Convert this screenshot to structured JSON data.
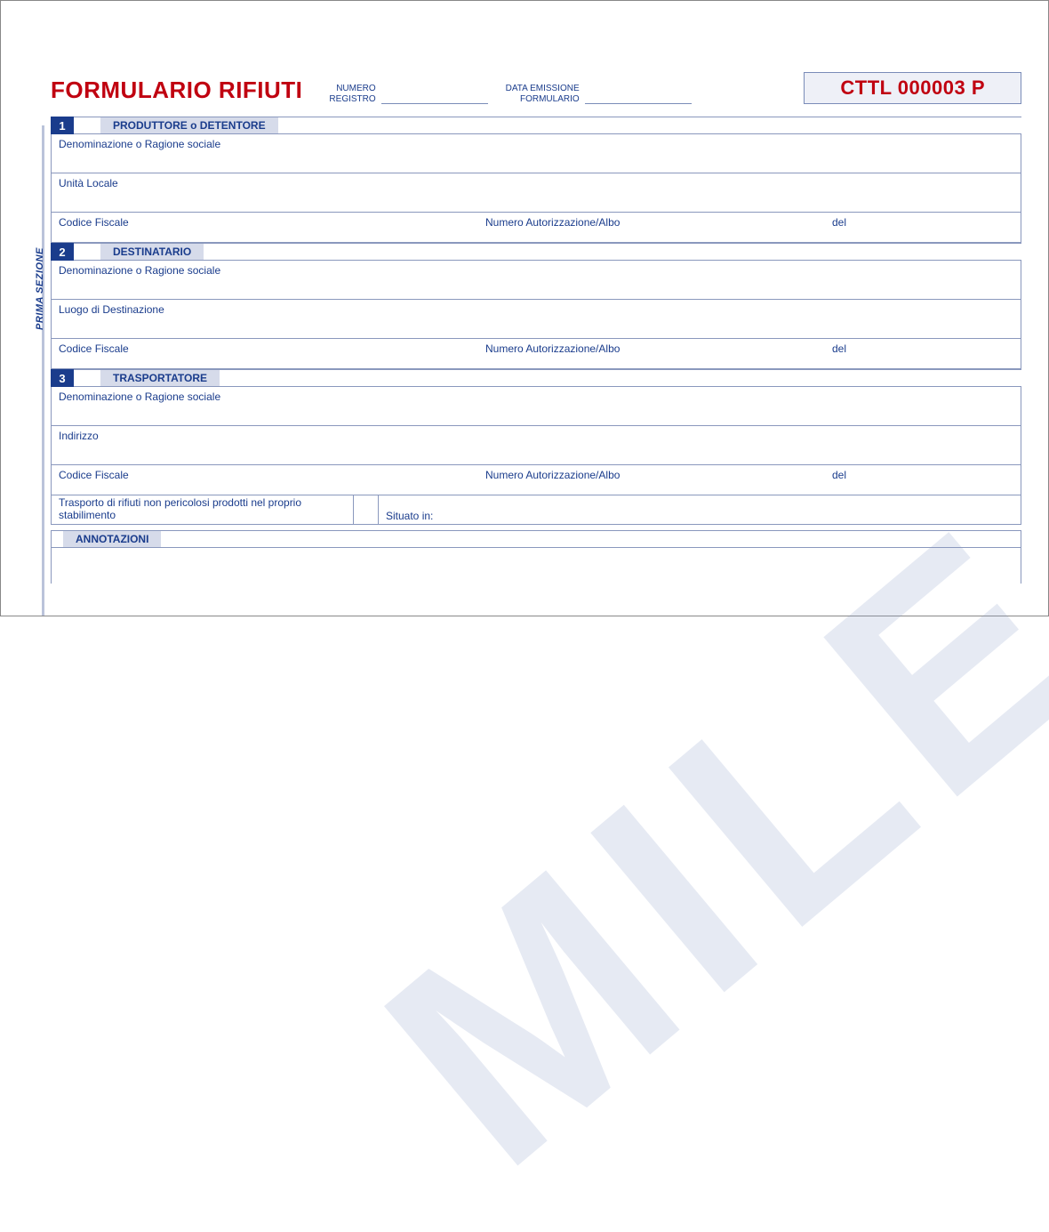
{
  "header": {
    "title": "FORMULARIO RIFIUTI",
    "numero_registro_label": "NUMERO\nREGISTRO",
    "data_emissione_label": "DATA EMISSIONE\nFORMULARIO",
    "serial": "CTTL 000003 P"
  },
  "side_label": "PRIMA SEZIONE",
  "sections": {
    "s1": {
      "num": "1",
      "title": "PRODUTTORE o DETENTORE",
      "row1": "Denominazione o Ragione sociale",
      "row2": "Unità Locale",
      "cf": "Codice Fiscale",
      "auth": "Numero Autorizzazione/Albo",
      "del": "del"
    },
    "s2": {
      "num": "2",
      "title": "DESTINATARIO",
      "row1": "Denominazione o Ragione sociale",
      "row2": "Luogo di Destinazione",
      "cf": "Codice Fiscale",
      "auth": "Numero Autorizzazione/Albo",
      "del": "del"
    },
    "s3": {
      "num": "3",
      "title": "TRASPORTATORE",
      "row1": "Denominazione o Ragione sociale",
      "row2": "Indirizzo",
      "cf": "Codice Fiscale",
      "auth": "Numero Autorizzazione/Albo",
      "del": "del",
      "transport_own": "Trasporto di rifiuti non pericolosi prodotti nel proprio stabilimento",
      "situato": "Situato in:"
    },
    "annot": {
      "title": "ANNOTAZIONI"
    }
  },
  "watermark": "MILE"
}
